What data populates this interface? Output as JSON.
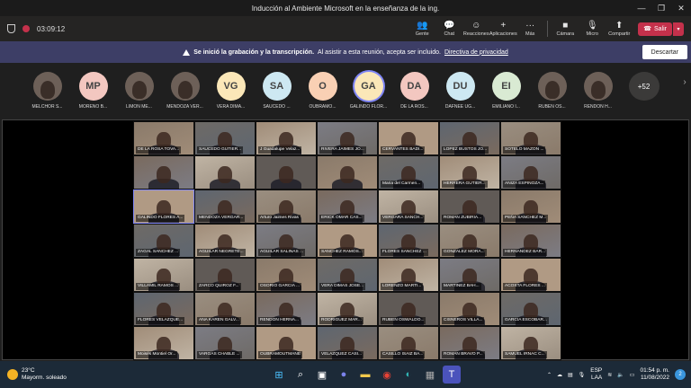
{
  "window": {
    "title": "Inducción al Ambiente Microsoft en la enseñanza de la ing."
  },
  "toolbar": {
    "timer": "03:09:12",
    "buttons": [
      {
        "label": "Gente",
        "icon": "people-icon",
        "glyph": "👥"
      },
      {
        "label": "Chat",
        "icon": "chat-icon",
        "glyph": "💬"
      },
      {
        "label": "Reacciones",
        "icon": "reactions-icon",
        "glyph": "☺"
      },
      {
        "label": "Aplicaciones",
        "icon": "apps-icon",
        "glyph": "+"
      },
      {
        "label": "Más",
        "icon": "more-icon",
        "glyph": "···"
      },
      {
        "label": "Cámara",
        "icon": "camera-icon",
        "glyph": "■"
      },
      {
        "label": "Micro",
        "icon": "mic-off-icon",
        "glyph": "🎙"
      },
      {
        "label": "Compartir",
        "icon": "share-icon",
        "glyph": "⬆"
      }
    ],
    "leave_label": "Salir"
  },
  "banner": {
    "bold": "Se inició la grabación y la transcripción.",
    "text": "Al asistir a esta reunión, acepta ser incluido.",
    "link": "Directiva de privacidad",
    "dismiss": "Descartar"
  },
  "gallery": {
    "attendees": [
      {
        "initials": "",
        "name": "MELCHOR S...",
        "color": "#6d6058"
      },
      {
        "initials": "MP",
        "name": "MORENO B...",
        "color": "#f3c7c0"
      },
      {
        "initials": "",
        "name": "LIMON ME...",
        "color": "#6d6058"
      },
      {
        "initials": "",
        "name": "MENDOZA VER...",
        "color": "#6d6058"
      },
      {
        "initials": "VG",
        "name": "VERA DIMA...",
        "color": "#fbe7b8"
      },
      {
        "initials": "SA",
        "name": "SAUCEDO ...",
        "color": "#cde8f2"
      },
      {
        "initials": "O",
        "name": "OUBRAMO...",
        "color": "#f9d0b4"
      },
      {
        "initials": "GA",
        "name": "GALINDO FLOR...",
        "color": "#fbe7b8"
      },
      {
        "initials": "DA",
        "name": "DE LA ROS...",
        "color": "#f3c7c0"
      },
      {
        "initials": "DU",
        "name": "DAFNEE UG...",
        "color": "#cde8f2"
      },
      {
        "initials": "EI",
        "name": "EMILIANO I...",
        "color": "#d9ead3"
      },
      {
        "initials": "",
        "name": "RUBEN OS...",
        "color": "#6d6058"
      },
      {
        "initials": "",
        "name": "RENDON H...",
        "color": "#6d6058"
      }
    ],
    "overflow": "+52"
  },
  "tiles": [
    "DE LA ROSA TOVA...",
    "SAUCEDO GUTIER...",
    "J Guadalupe Velaz...",
    "RIVERA JAIMES JO...",
    "CERVANTES BADI...",
    "LOPEZ BUSTOS JO...",
    "SOTELO MAZON ...",
    "",
    "",
    "",
    "",
    "Maria del Carmen...",
    "HERRERA GUTIER...",
    "ANIZA ESPINOZA...",
    "GALINDO FLORES A...",
    "MENDOZA VERGAR...",
    "Arturo Jaimes Rivas",
    "ERICK OMAR CAS...",
    "VERGARA SANCH...",
    "ROMAN ZUBIRIA...",
    "PEÑA SANCHEZ M...",
    "ZAGAL SANCHEZ ...",
    "AGUILAR NEGRETE...",
    "AGUILAR SALINAS ...",
    "SANCHEZ RAMOS...",
    "FLORES SANCHEZ ...",
    "GONZALEZ MORA...",
    "HERNANDEZ BAR...",
    "VILLAMIL RAMOS ...",
    "ZARCO QUIROZ F...",
    "OSORIO GARCIA ...",
    "VERA DIMAS JOSE...",
    "LORENZO MARTI...",
    "MARTINEZ BAH...",
    "ACOSTA FLORES ...",
    "FLORES VELAZQUE...",
    "ANA KAREN GALV...",
    "RENDON HERNA...",
    "RODRIGUEZ MAR...",
    "RUBEN OSWALDO...",
    "CISNEROS VILLA...",
    "GARCIA ESCOBAR...",
    "Moisés Montiel Or...",
    "VARGAS CHABLE ...",
    "OUBRAMOUTMANE",
    "VELAZQUEZ CASI...",
    "CASILLO ISAIZ BA...",
    "ROMAN BRAVO P...",
    "SAMUEL IRNAC C..."
  ],
  "taskbar": {
    "temp": "23°C",
    "weather": "Mayorm. soleado",
    "lang": "ESP",
    "lang2": "LAA",
    "time": "01:54 p. m.",
    "date": "11/08/2022",
    "notifications": "2"
  }
}
